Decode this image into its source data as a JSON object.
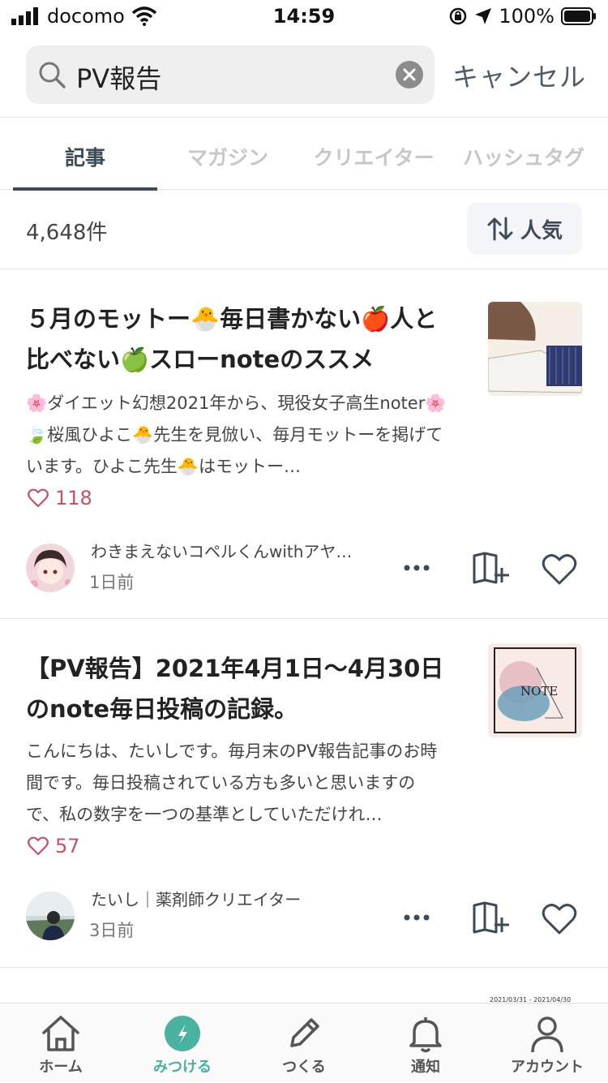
{
  "status_bar": {
    "carrier": "docomo",
    "time": "14:59",
    "battery": "100%"
  },
  "search": {
    "query": "PV報告",
    "cancel_label": "キャンセル"
  },
  "tabs": [
    {
      "label": "記事",
      "active": true
    },
    {
      "label": "マガジン",
      "active": false
    },
    {
      "label": "クリエイター",
      "active": false
    },
    {
      "label": "ハッシュタグ",
      "active": false
    }
  ],
  "results": {
    "count_label": "4,648件",
    "sort_label": "人気"
  },
  "articles": [
    {
      "title": "５月のモットー🐣毎日書かない🍎人と比べない🍏スローnoteのススメ",
      "excerpt": "🌸ダイエット幻想2021年から、現役女子高生noter🌸🍃桜風ひよこ🐣先生を見倣い、毎月モットーを掲げています。ひよこ先生🐣はモットー…",
      "likes": "118",
      "author": "わきまえないコペルくんwithアヤ…",
      "time": "1日前",
      "more_icon": "more-icon",
      "save_icon": "magazine-add-icon",
      "like_icon": "heart-icon"
    },
    {
      "title": "【PV報告】2021年4月1日〜4月30日のnote毎日投稿の記録。",
      "excerpt": "こんにちは、たいしです。毎月末のPV報告記事のお時間です。毎日投稿されている方も多いと思いますので、私の数字を一つの基準としていただけれ…",
      "likes": "57",
      "author": "たいし｜薬剤師クリエイター",
      "time": "3日前",
      "thumb_text": "NOTE",
      "more_icon": "more-icon",
      "save_icon": "magazine-add-icon",
      "like_icon": "heart-icon"
    }
  ],
  "peek": {
    "date_text": "2021/03/31 - 2021/04/30"
  },
  "bottom_nav": [
    {
      "label": "ホーム",
      "icon": "home-icon",
      "active": false
    },
    {
      "label": "みつける",
      "icon": "compass-icon",
      "active": true
    },
    {
      "label": "つくる",
      "icon": "pencil-icon",
      "active": false
    },
    {
      "label": "通知",
      "icon": "bell-icon",
      "active": false
    },
    {
      "label": "アカウント",
      "icon": "person-icon",
      "active": false
    }
  ],
  "colors": {
    "accent": "#49b2a0",
    "tab_active": "#3e4a57",
    "like": "#c0536a"
  }
}
